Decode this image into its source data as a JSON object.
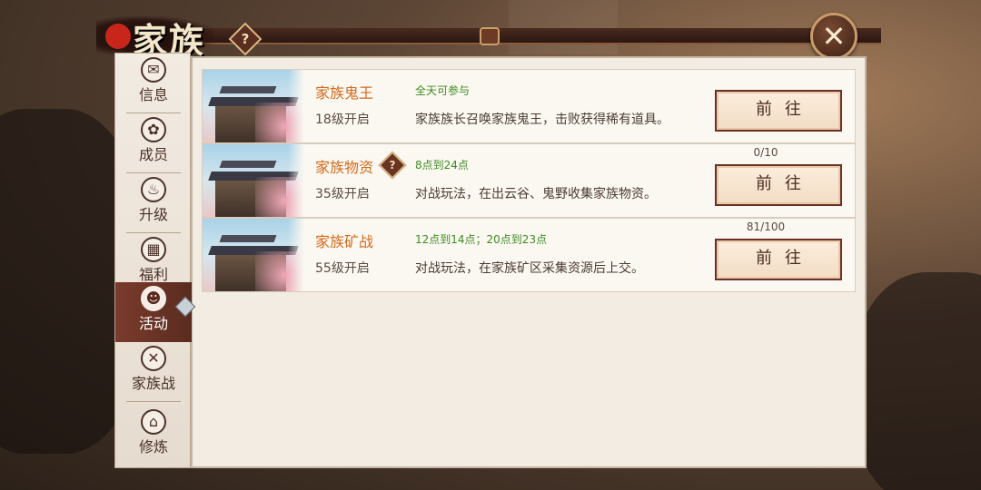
{
  "header": {
    "title": "家族",
    "help": "?",
    "close": "✕"
  },
  "sidebar": {
    "tabs": [
      {
        "label": "信息",
        "icon": "mail-icon",
        "glyph": "✉"
      },
      {
        "label": "成员",
        "icon": "members-icon",
        "glyph": "✿"
      },
      {
        "label": "升级",
        "icon": "upgrade-icon",
        "glyph": "♨"
      },
      {
        "label": "福利",
        "icon": "gift-icon",
        "glyph": "▦"
      },
      {
        "label": "活动",
        "icon": "activity-icon",
        "glyph": "☻",
        "active": true
      },
      {
        "label": "家族战",
        "icon": "crossed-swords-icon",
        "glyph": "✕"
      },
      {
        "label": "修炼",
        "icon": "temple-icon",
        "glyph": "⌂"
      }
    ]
  },
  "activities": [
    {
      "name": "家族鬼王",
      "level": "18级开启",
      "time": "全天可参与",
      "desc": "家族族长召唤家族鬼王，击败获得稀有道具。",
      "progress": "",
      "button": "前往"
    },
    {
      "name": "家族物资",
      "level": "35级开启",
      "time": "8点到24点",
      "desc": "对战玩法，在出云谷、鬼野收集家族物资。",
      "progress": "0/10",
      "button": "前往"
    },
    {
      "name": "家族矿战",
      "level": "55级开启",
      "time": "12点到14点；20点到23点",
      "desc": "对战玩法，在家族矿区采集资源后上交。",
      "progress": "81/100",
      "button": "前往"
    }
  ],
  "colors": {
    "accent": "#d46a1c",
    "time_green": "#3f8a20",
    "active_tab": "#6a3326"
  }
}
